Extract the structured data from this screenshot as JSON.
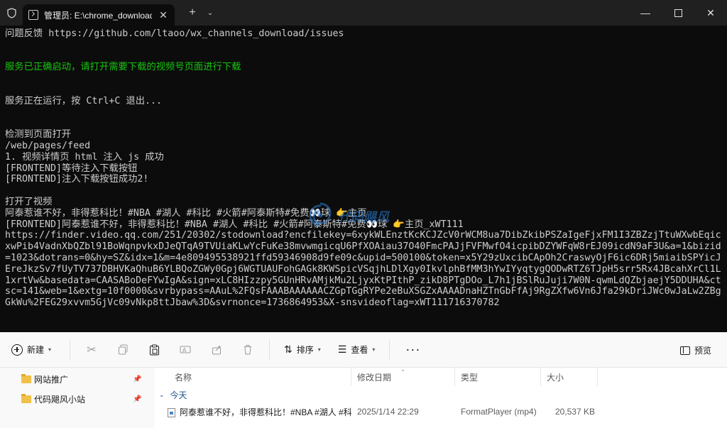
{
  "terminal": {
    "tab_title": "管理员: E:\\chrome_download\\",
    "new_tab": "+",
    "lines": [
      {
        "text": "问题反馈 https://github.com/ltaoo/wx_channels_download/issues",
        "style": "normal"
      },
      {
        "text": "",
        "style": "blank"
      },
      {
        "text": "",
        "style": "blank"
      },
      {
        "text": "服务已正确启动，请打开需要下载的视频号页面进行下载",
        "style": "green"
      },
      {
        "text": "",
        "style": "blank"
      },
      {
        "text": "",
        "style": "blank"
      },
      {
        "text": "服务正在运行，按 Ctrl+C 退出...",
        "style": "normal"
      },
      {
        "text": "",
        "style": "blank"
      },
      {
        "text": "",
        "style": "blank"
      },
      {
        "text": "检测到页面打开",
        "style": "normal"
      },
      {
        "text": "/web/pages/feed",
        "style": "normal"
      },
      {
        "text": "1. 视频详情页 html 注入 js 成功",
        "style": "normal"
      },
      {
        "text": "[FRONTEND]等待注入下载按钮",
        "style": "normal"
      },
      {
        "text": "[FRONTEND]注入下载按钮成功2!",
        "style": "normal"
      },
      {
        "text": "",
        "style": "blank"
      },
      {
        "text": "打开了视频",
        "style": "normal"
      },
      {
        "text": "阿泰惹谁不好，非得惹科比！#NBA #湖人 #科比 #火箭#阿泰斯特#免费👀球 👉主页",
        "style": "normal"
      },
      {
        "text": "[FRONTEND]阿泰惹谁不好，非得惹科比！#NBA #湖人 #科比 #火箭#阿泰斯特#免费👀球 👉主页_xWT111",
        "style": "normal"
      },
      {
        "text": "https://finder.video.qq.com/251/20302/stodownload?encfilekey=6xykWLEnztKcKCJZcV0rWCM8ua7DibZkibPSZaIgeFjxFM1I3ZBZzjTtuWXwbEqicxwPib4VadnXbQZbl91BoWqnpvkxDJeQTqA9TVUiaKLwYcFuKe38mvwmgicqU6PfXOAiau37O40FmcPAJjFVFMwfO4icpibDZYWFqW8rEJ09icdN9aF3U&a=1&bizid=1023&dotrans=0&hy=SZ&idx=1&m=4e809495538921ffd59346908d9fe09c&upid=500100&token=x5Y29zUxcibCApOh2CraswyOjF6ic6DRj5miaibSPYicJEreJkzSv7fUyTV737DBHVKaQhuB6YLBQoZGWy0Gpj6WGTUAUFohGAGk8KWSpicVSqjhLDlXgy0IkvlphBfMM3hYwIYyqtygQODwRTZ6TJpH5srr5Rx4JBcahXrCl1L1xrtVw&basedata=CAASABoDeFYwIgA&sign=xLC8HIzzpy5GUnHRvAMjkMu2LjyxKtPIthP_zikD8PTgDOo_L7h1jBSlRuJuji7W0N-qwmLdQZbjaejY5DDUHA&ctsc=141&web=1&extg=10f0000&svrbypass=AAuL%2FQsFAAABAAAAAACZGpTGgRYPe2eBuXSGZxAAAADnaHZTnGbFfAj9RgZXfw6Vn6Jfa29kDriJWc0wJaLw2ZBgGkWu%2FEG29xvvm5GjVc09vNkp8ttJbaw%3D&svrnonce=1736864953&X-snsvideoflag=xWT111716370782",
        "style": "wrap"
      }
    ],
    "watermark": "代码飓风"
  },
  "explorer": {
    "toolbar": {
      "new_label": "新建",
      "sort_label": "排序",
      "view_label": "查看",
      "more_label": "···",
      "preview_label": "预览"
    },
    "nav_items": [
      {
        "label": "网站推广"
      },
      {
        "label": "代码飓风小站"
      }
    ],
    "columns": {
      "name": "名称",
      "date": "修改日期",
      "type": "类型",
      "size": "大小"
    },
    "group_label": "今天",
    "files": [
      {
        "name": "阿泰惹谁不好，非得惹科比！#NBA #湖人 #科...",
        "date": "2025/1/14 22:29",
        "type": "FormatPlayer (mp4)",
        "size": "20,537 KB"
      }
    ]
  }
}
